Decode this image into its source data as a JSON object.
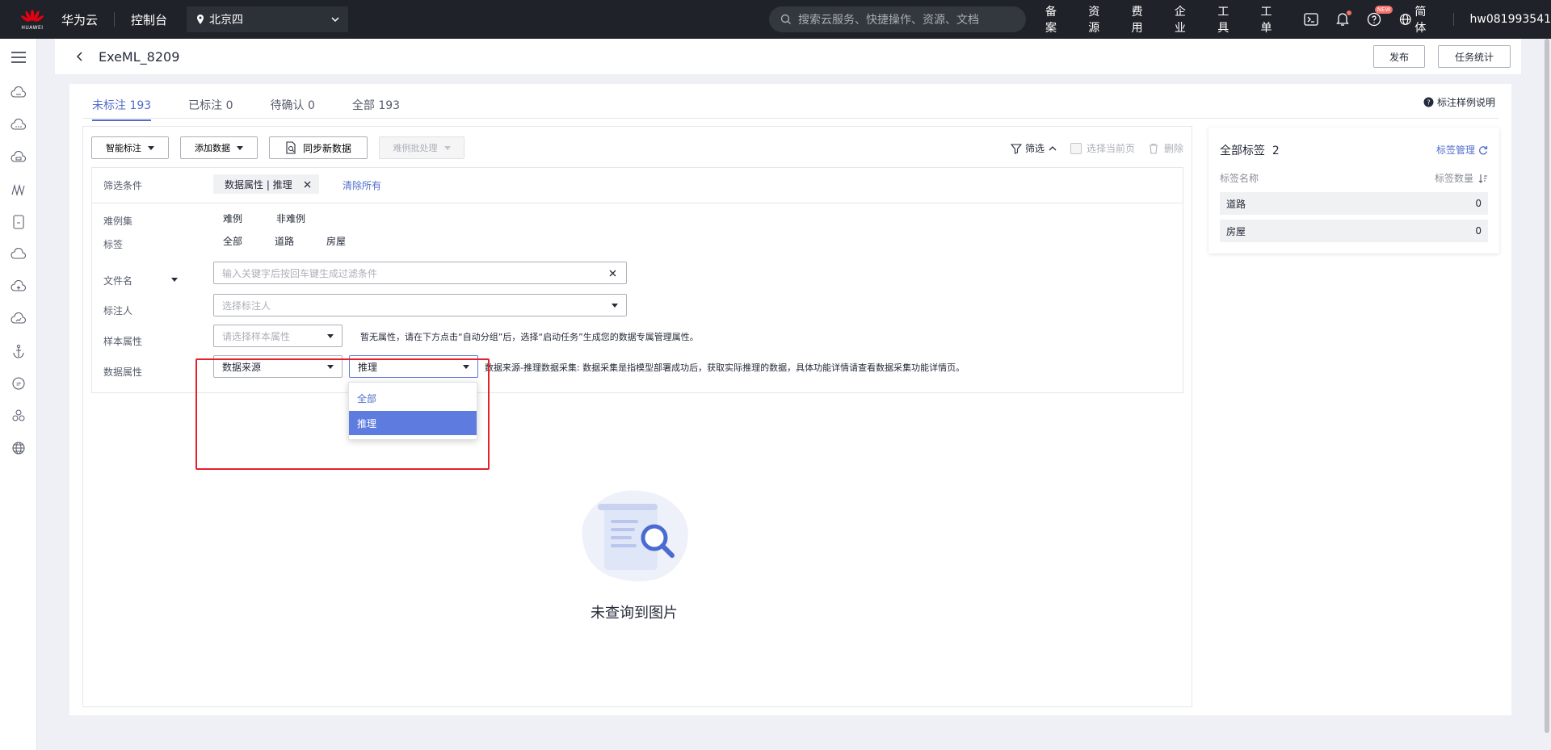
{
  "topbar": {
    "logo_sub": "HUAWEI",
    "brand": "华为云",
    "console": "控制台",
    "region": "北京四",
    "search_placeholder": "搜索云服务、快捷操作、资源、文档",
    "links": [
      "备案",
      "资源",
      "费用",
      "企业",
      "工具",
      "工单"
    ],
    "new_badge": "NEW",
    "language": "简体",
    "username": "hw081993541"
  },
  "header": {
    "title": "ExeML_8209",
    "publish": "发布",
    "stats": "任务统计"
  },
  "tabs": [
    {
      "label": "未标注 193",
      "active": true
    },
    {
      "label": "已标注 0"
    },
    {
      "label": "待确认 0"
    },
    {
      "label": "全部 193"
    }
  ],
  "help": "标注样例说明",
  "toolbar": {
    "smart": "智能标注",
    "add": "添加数据",
    "sync": "同步新数据",
    "hard": "难例批处理",
    "filter": "筛选",
    "select_page": "选择当前页",
    "delete": "删除"
  },
  "filter": {
    "cond_label": "筛选条件",
    "chip": "数据属性 | 推理",
    "clear_all": "清除所有",
    "hard_label": "难例集",
    "hard_opts": [
      "难例",
      "非难例"
    ],
    "tag_label": "标签",
    "tag_opts": [
      "全部",
      "道路",
      "房屋"
    ],
    "file_label": "文件名",
    "file_placeholder": "输入关键字后按回车键生成过滤条件",
    "annotator_label": "标注人",
    "annotator_placeholder": "选择标注人",
    "sample_label": "样本属性",
    "sample_placeholder": "请选择样本属性",
    "sample_note": "暂无属性，请在下方点击“自动分组”后，选择“启动任务”生成您的数据专属管理属性。",
    "data_label": "数据属性",
    "data_source": "数据来源",
    "data_value": "推理",
    "data_note": "数据来源-推理数据采集: 数据采集是指模型部署成功后，获取实际推理的数据，具体功能详情请查看数据采集功能详情页。",
    "dropdown": [
      "全部",
      "推理"
    ]
  },
  "empty_text": "未查询到图片",
  "labels": {
    "title": "全部标签",
    "count": "2",
    "manage": "标签管理",
    "col_name": "标签名称",
    "col_count": "标签数量",
    "rows": [
      {
        "name": "道路",
        "count": "0"
      },
      {
        "name": "房屋",
        "count": "0"
      }
    ]
  }
}
